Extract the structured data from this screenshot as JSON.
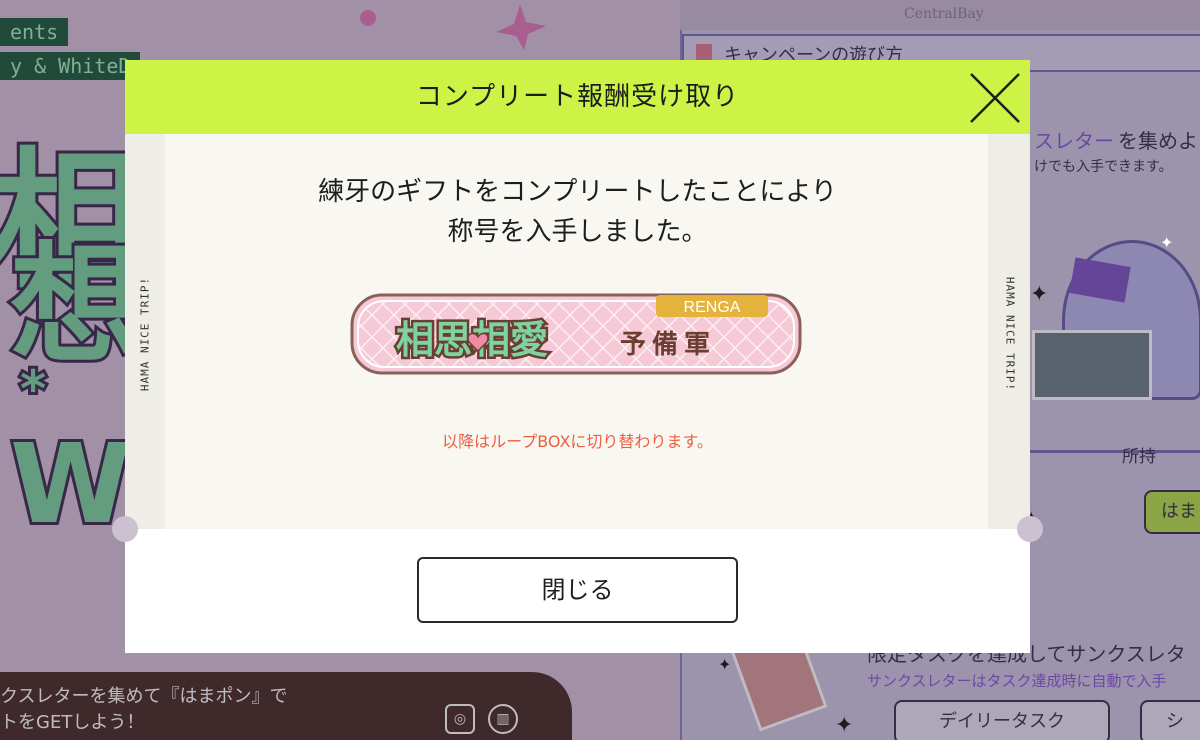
{
  "background": {
    "left_tags": [
      "ents",
      "y & WhiteD"
    ],
    "big_chars": [
      "相",
      "想",
      "Wi",
      "*"
    ],
    "bottom_banner": {
      "line1": "クスレターを集めて『はまポン』で",
      "line2": "トをGETしよう！"
    },
    "right_panel": {
      "watermark": "CentralBay",
      "how_to": "キャンペーンの遊び方",
      "collect_prefix": "スレター",
      "collect_suffix": "を集めよ",
      "collect_sub": "けでも入手できます。",
      "owned_label": "所持",
      "green_button": "はま",
      "task_heading": "限定タスクを達成してサンクスレタ",
      "task_sub": "サンクスレターはタスク達成時に自動で入手",
      "daily_task_button": "デイリータスク",
      "other_button": "シ"
    }
  },
  "modal": {
    "title": "コンプリート報酬受け取り",
    "side_text_left": "HAMA NICE TRIP!",
    "side_text_right": "HAMA NICE TRIP!",
    "message_line1": "練牙のギフトをコンプリートしたことにより",
    "message_line2": "称号を入手しました。",
    "badge": {
      "main": "相思相愛",
      "sub": "予備軍",
      "tag": "RENGA"
    },
    "notice": "以降はループBOXに切り替わります。",
    "close_button": "閉じる"
  },
  "colors": {
    "header_lime": "#ccf345",
    "notice_red": "#ee5f42",
    "badge_pink": "#f6c9d7",
    "badge_text_green": "#7fd3a0",
    "tag_gold": "#e3b33c"
  },
  "icons": [
    "close-x-icon",
    "sparkle-icon",
    "flag-icon",
    "heart-icon"
  ]
}
